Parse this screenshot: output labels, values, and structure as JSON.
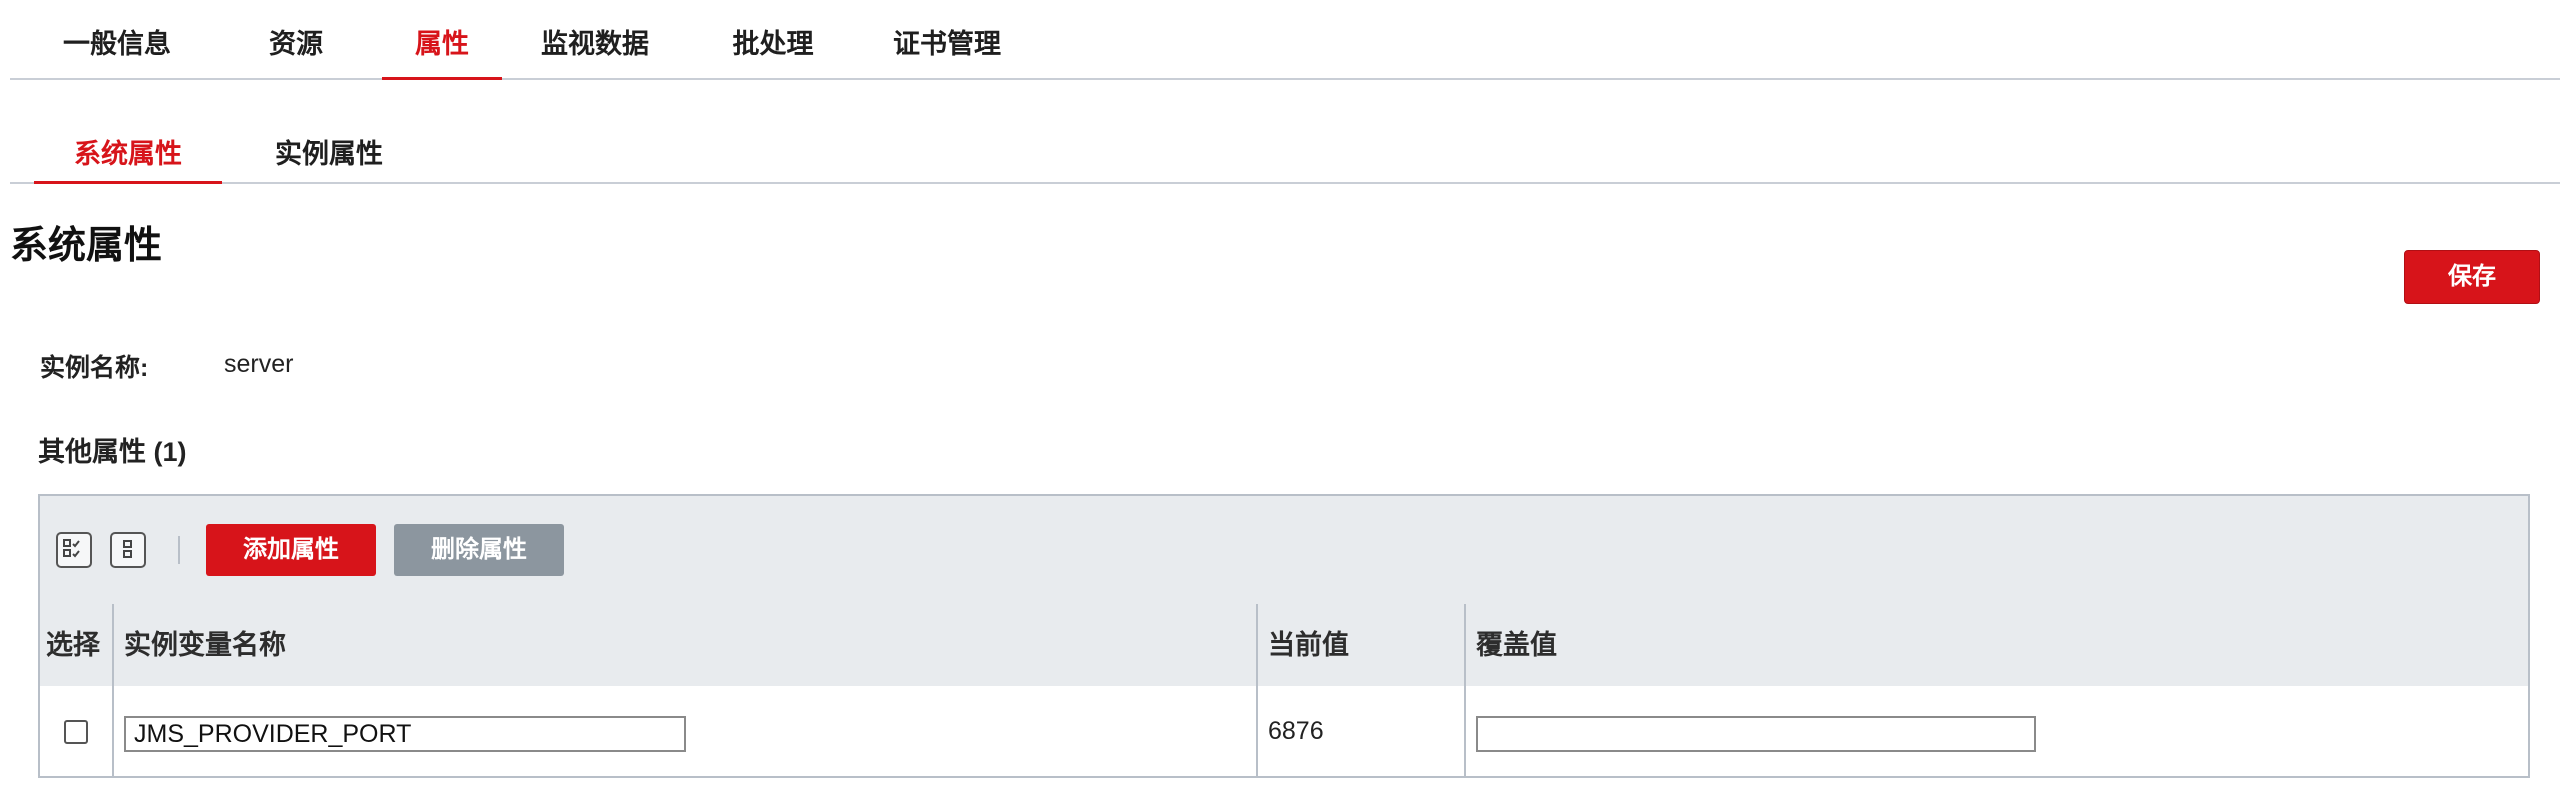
{
  "top_tabs": [
    {
      "label": "一般信息",
      "active": false
    },
    {
      "label": "资源",
      "active": false
    },
    {
      "label": "属性",
      "active": true
    },
    {
      "label": "监视数据",
      "active": false
    },
    {
      "label": "批处理",
      "active": false
    },
    {
      "label": "证书管理",
      "active": false
    }
  ],
  "sub_tabs": [
    {
      "label": "系统属性",
      "active": true
    },
    {
      "label": "实例属性",
      "active": false
    }
  ],
  "page_title": "系统属性",
  "save_button": "保存",
  "instance": {
    "label": "实例名称:",
    "value": "server"
  },
  "other_properties_title": "其他属性 (1)",
  "toolbar": {
    "select_all_icon": "select-all-icon",
    "deselect_all_icon": "deselect-all-icon",
    "add_label": "添加属性",
    "delete_label": "删除属性"
  },
  "table": {
    "headers": [
      "选择",
      "实例变量名称",
      "当前值",
      "覆盖值"
    ],
    "rows": [
      {
        "name": "JMS_PROVIDER_PORT",
        "current": "6876",
        "override": ""
      }
    ]
  },
  "colors": {
    "accent": "#d7141a",
    "disabled_button": "#8c969f"
  }
}
